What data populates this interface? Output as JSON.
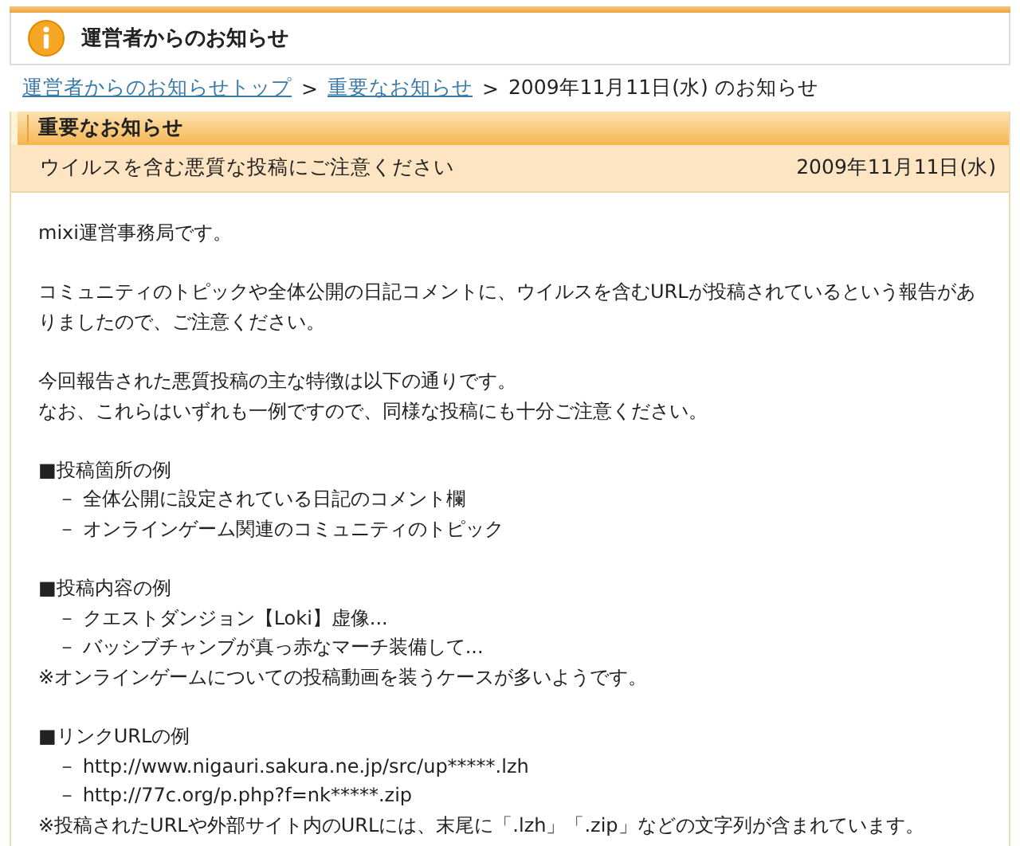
{
  "header": {
    "title": "運営者からのお知らせ"
  },
  "breadcrumb": [
    {
      "label": "運営者からのお知らせトップ",
      "kind": "link"
    },
    {
      "label": ">",
      "kind": "sep"
    },
    {
      "label": "重要なお知らせ",
      "kind": "link"
    },
    {
      "label": ">",
      "kind": "sep"
    },
    {
      "label": "2009年11月11日(水) のお知らせ",
      "kind": "text"
    }
  ],
  "section": {
    "title": "重要なお知らせ",
    "subject": "ウイルスを含む悪質な投稿にご注意ください",
    "date": "2009年11月11日(水)"
  },
  "paragraphs": [
    [
      {
        "kind": "text",
        "text": "mixi運営事務局です。"
      }
    ],
    [
      {
        "kind": "text",
        "text": "コミュニティのトピックや全体公開の日記コメントに、ウイルスを含むURLが投稿されているという報告がありましたので、ご注意ください。"
      }
    ],
    [
      {
        "kind": "text",
        "text": "今回報告された悪質投稿の主な特徴は以下の通りです。"
      },
      {
        "kind": "text",
        "text": "なお、これらはいずれも一例ですので、同様な投稿にも十分ご注意ください。"
      }
    ],
    [
      {
        "kind": "heading",
        "text": "■投稿箇所の例"
      },
      {
        "kind": "item",
        "text": "－ 全体公開に設定されている日記のコメント欄"
      },
      {
        "kind": "item",
        "text": "－ オンラインゲーム関連のコミュニティのトピック"
      }
    ],
    [
      {
        "kind": "heading",
        "text": "■投稿内容の例"
      },
      {
        "kind": "item",
        "text": "－ クエストダンジョン【Loki】虚像..."
      },
      {
        "kind": "item",
        "text": "－ バッシブチャンブが真っ赤なマーチ装備して..."
      },
      {
        "kind": "note",
        "text": "※オンラインゲームについての投稿動画を装うケースが多いようです。"
      }
    ],
    [
      {
        "kind": "heading",
        "text": "■リンクURLの例"
      },
      {
        "kind": "item",
        "text": "－ http://www.nigauri.sakura.ne.jp/src/up*****.lzh"
      },
      {
        "kind": "item",
        "text": "－ http://77c.org/p.php?f=nk*****.zip"
      },
      {
        "kind": "note",
        "text": "※投稿されたURLや外部サイト内のURLには、末尾に「.lzh」「.zip」などの文字列が含まれています。"
      }
    ]
  ]
}
